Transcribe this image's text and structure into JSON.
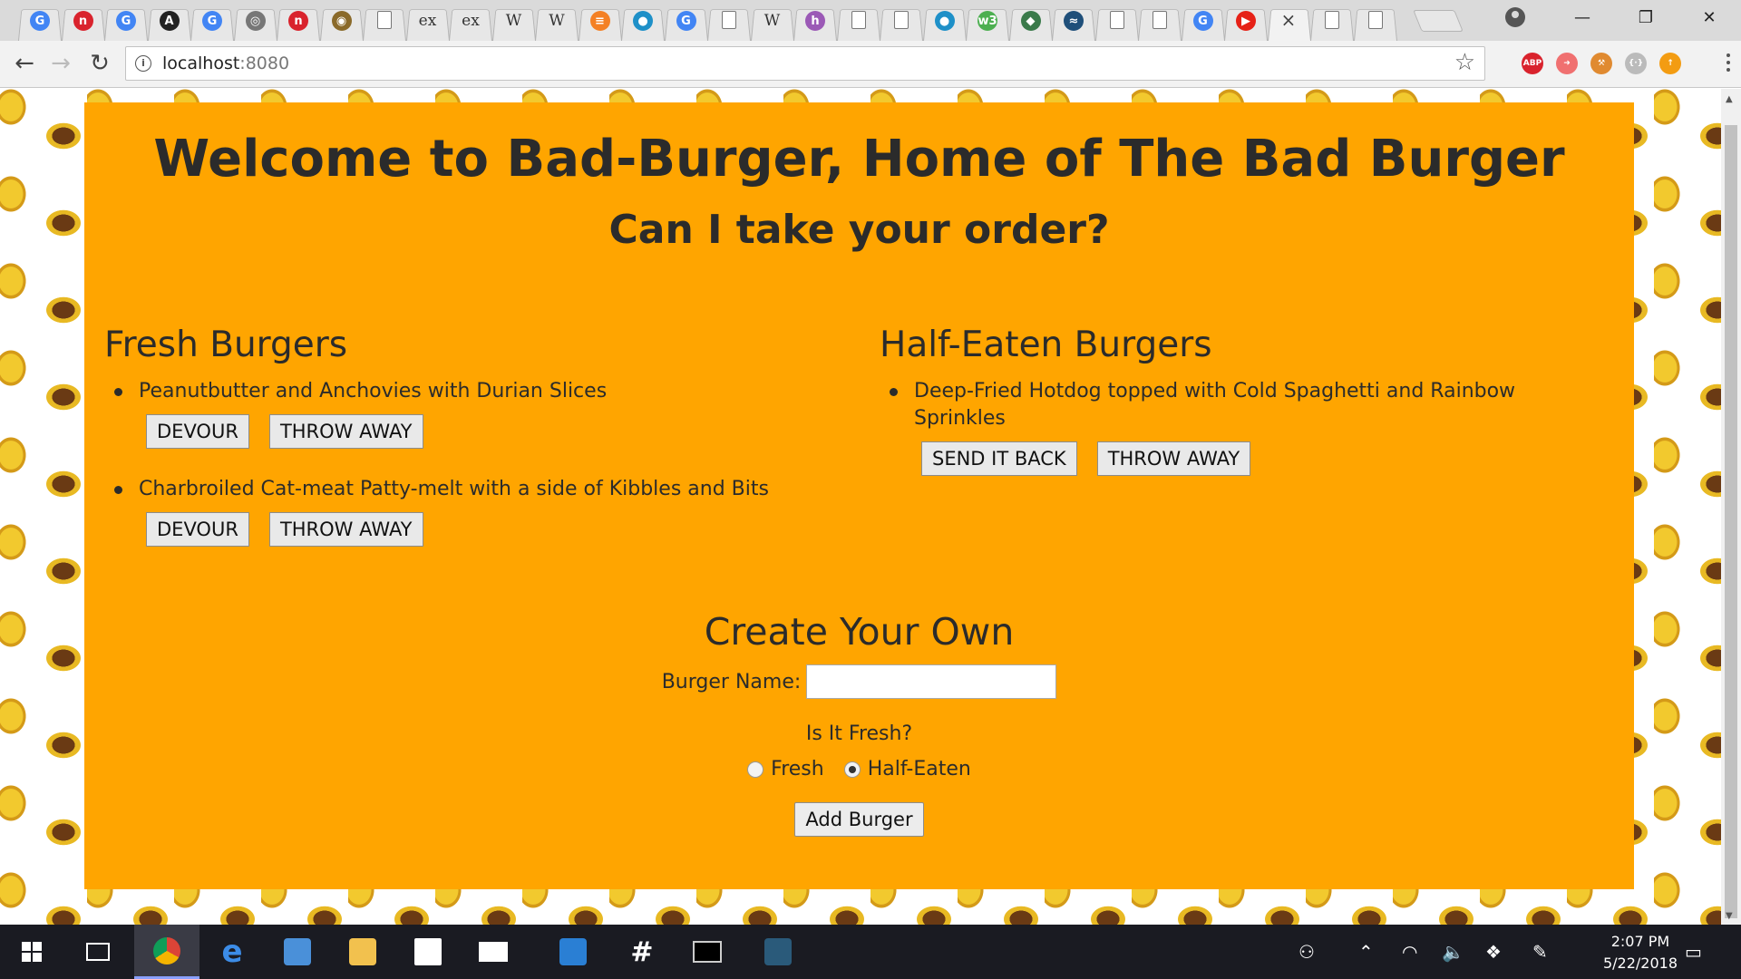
{
  "browser": {
    "url_host": "localhost",
    "url_port": ":8080",
    "tabs": [
      {
        "icon": "google-icon",
        "glyph": "G",
        "color": "#4285f4"
      },
      {
        "icon": "nature-icon",
        "glyph": "n",
        "color": "#d9232d"
      },
      {
        "icon": "google-icon",
        "glyph": "G",
        "color": "#4285f4"
      },
      {
        "icon": "a-logo-icon",
        "glyph": "A",
        "color": "#222222"
      },
      {
        "icon": "google-icon",
        "glyph": "G",
        "color": "#4285f4"
      },
      {
        "icon": "glasses-icon",
        "glyph": "◎",
        "color": "#777777"
      },
      {
        "icon": "nature-icon",
        "glyph": "n",
        "color": "#d9232d"
      },
      {
        "icon": "owl-icon",
        "glyph": "◉",
        "color": "#8a6a2a"
      },
      {
        "icon": "page-icon",
        "glyph": "",
        "color": "#ffffff"
      },
      {
        "icon": "ex-icon",
        "glyph": "ex",
        "color": "transparent"
      },
      {
        "icon": "ex-icon",
        "glyph": "ex",
        "color": "transparent"
      },
      {
        "icon": "wikipedia-icon",
        "glyph": "W",
        "color": "transparent"
      },
      {
        "icon": "wikipedia-icon",
        "glyph": "W",
        "color": "transparent"
      },
      {
        "icon": "stackoverflow-icon",
        "glyph": "≡",
        "color": "#f48024"
      },
      {
        "icon": "brain-icon",
        "glyph": "●",
        "color": "#1e90c8"
      },
      {
        "icon": "google-icon",
        "glyph": "G",
        "color": "#4285f4"
      },
      {
        "icon": "page-icon",
        "glyph": "",
        "color": "#ffffff"
      },
      {
        "icon": "wikipedia-icon",
        "glyph": "W",
        "color": "transparent"
      },
      {
        "icon": "h-icon",
        "glyph": "h",
        "color": "#9b59b6"
      },
      {
        "icon": "page-icon",
        "glyph": "",
        "color": "#ffffff"
      },
      {
        "icon": "page-icon",
        "glyph": "",
        "color": "#ffffff"
      },
      {
        "icon": "brain-icon",
        "glyph": "●",
        "color": "#1e90c8"
      },
      {
        "icon": "w3-icon",
        "glyph": "w3",
        "color": "#4caf50"
      },
      {
        "icon": "diamond-icon",
        "glyph": "◆",
        "color": "#3a7a4a"
      },
      {
        "icon": "mysql-icon",
        "glyph": "≈",
        "color": "#1f4f7a"
      },
      {
        "icon": "page-icon",
        "glyph": "",
        "color": "#ffffff"
      },
      {
        "icon": "page-icon",
        "glyph": "",
        "color": "#ffffff"
      },
      {
        "icon": "google-icon",
        "glyph": "G",
        "color": "#4285f4"
      },
      {
        "icon": "youtube-icon",
        "glyph": "▶",
        "color": "#e62117"
      },
      {
        "icon": "active-tab",
        "glyph": "×",
        "color": "transparent"
      },
      {
        "icon": "page-icon",
        "glyph": "",
        "color": "#ffffff"
      },
      {
        "icon": "page-icon",
        "glyph": "",
        "color": "#ffffff"
      }
    ],
    "extensions": [
      {
        "name": "adblock-icon",
        "label": "ABP",
        "color": "#d9232d"
      },
      {
        "name": "arrow-extension-icon",
        "label": "➜",
        "color": "#f07070"
      },
      {
        "name": "hammer-extension-icon",
        "label": "⚒",
        "color": "#e08a30"
      },
      {
        "name": "bracket-extension-icon",
        "label": "{·}",
        "color": "#bbbbbb"
      },
      {
        "name": "update-icon",
        "label": "↑",
        "color": "#f39c12"
      }
    ]
  },
  "page": {
    "title": "Welcome to Bad-Burger, Home of The Bad Burger",
    "subtitle": "Can I take your order?",
    "fresh": {
      "heading": "Fresh Burgers",
      "items": [
        {
          "name": "Peanutbutter and Anchovies with Durian Slices",
          "btn1": "DEVOUR",
          "btn2": "THROW AWAY"
        },
        {
          "name": "Charbroiled Cat-meat Patty-melt with a side of Kibbles and Bits",
          "btn1": "DEVOUR",
          "btn2": "THROW AWAY"
        }
      ]
    },
    "half": {
      "heading": "Half-Eaten Burgers",
      "items": [
        {
          "name": "Deep-Fried Hotdog topped with Cold Spaghetti and Rainbow Sprinkles",
          "btn1": "SEND IT BACK",
          "btn2": "THROW AWAY"
        }
      ]
    },
    "create": {
      "heading": "Create Your Own",
      "name_label": "Burger Name:",
      "name_value": "",
      "fresh_question": "Is It Fresh?",
      "option_fresh": "Fresh",
      "option_half": "Half-Eaten",
      "selected": "Half-Eaten",
      "submit": "Add Burger"
    },
    "colors": {
      "panel": "#ffa500",
      "text": "#2b2b2b"
    }
  },
  "taskbar": {
    "time": "2:07 PM",
    "date": "5/22/2018"
  }
}
